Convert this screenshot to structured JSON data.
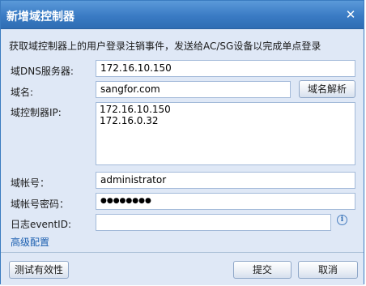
{
  "window": {
    "title": "新增域控制器",
    "close_glyph": "✕"
  },
  "description": "获取域控制器上的用户登录注销事件，发送给AC/SG设备以完成单点登录",
  "form": {
    "dns_server": {
      "label": "域DNS服务器:",
      "value": "172.16.10.150"
    },
    "domain": {
      "label": "域名:",
      "value": "sangfor.com",
      "resolve_button": "域名解析"
    },
    "domain_controller_ip": {
      "label": "域控制器IP:",
      "lines": [
        "172.16.10.150",
        "172.16.0.32"
      ]
    },
    "account": {
      "label": "域帐号：",
      "value": "administrator"
    },
    "password": {
      "label": "域帐号密码：",
      "value": "●●●●●●●●"
    },
    "event_id": {
      "label": "日志eventID:",
      "value": "",
      "info_icon": "info-icon"
    },
    "advanced_link": "高级配置"
  },
  "footer": {
    "test_button": "测试有效性",
    "submit_button": "提交",
    "cancel_button": "取消"
  },
  "colors": {
    "title_bar": "#3a7bc4",
    "panel_bg": "#dfe8f6",
    "input_border": "#a3bad9",
    "link": "#1c5fb0"
  }
}
